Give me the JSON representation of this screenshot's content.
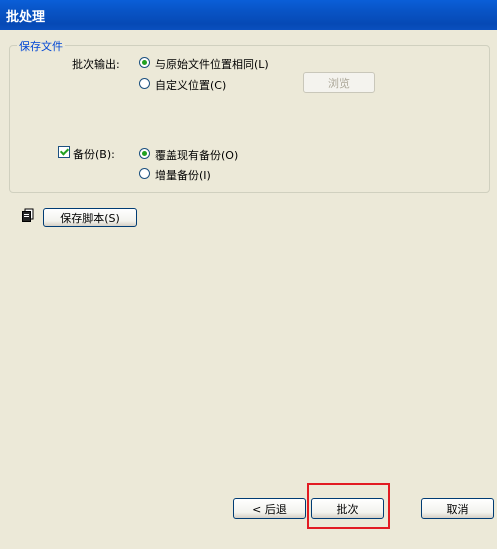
{
  "window": {
    "title": "批处理"
  },
  "save_group": {
    "legend": "保存文件",
    "batch_output_label": "批次输出:",
    "option_same_location": "与原始文件位置相同(L)",
    "option_custom_location": "自定义位置(C)",
    "browse_label": "浏览",
    "backup_label": "备份(B):",
    "backup_checked": true,
    "option_overwrite": "覆盖现有备份(O)",
    "option_incremental": "增量备份(I)",
    "selected_output": "same",
    "selected_backup": "overwrite"
  },
  "save_script": {
    "label": "保存脚本(S)",
    "icon": "document-copy-icon"
  },
  "footer": {
    "back_label": "< 后退",
    "batch_label": "批次",
    "cancel_label": "取消"
  }
}
